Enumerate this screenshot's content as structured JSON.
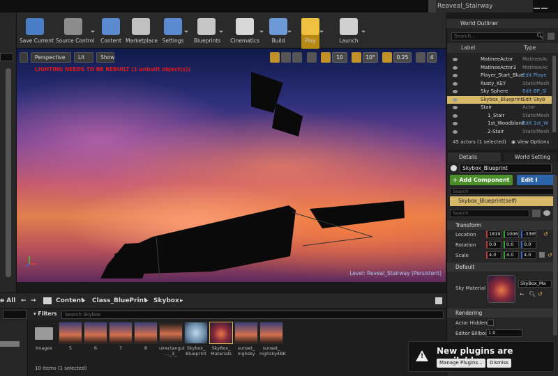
{
  "window": {
    "level_tab": "Reaveal_Stairway"
  },
  "toolbar": {
    "buttons": [
      {
        "label": "Save Current",
        "icon": "save-icon",
        "color": "#4a7fc8"
      },
      {
        "label": "Source Control",
        "icon": "source-control-icon",
        "color": "#8c8c8c"
      },
      {
        "label": "Content",
        "icon": "content-icon",
        "color": "#5a8ad0"
      },
      {
        "label": "Marketplace",
        "icon": "marketplace-icon",
        "color": "#c0c0c0"
      },
      {
        "label": "Settings",
        "icon": "settings-icon",
        "color": "#5a8ad0"
      },
      {
        "label": "Blueprints",
        "icon": "blueprints-icon",
        "color": "#c6c6c6"
      },
      {
        "label": "Cinematics",
        "icon": "cinematics-icon",
        "color": "#d8d8d8"
      },
      {
        "label": "Build",
        "icon": "build-icon",
        "color": "#6d9ad6"
      },
      {
        "label": "Play",
        "icon": "play-icon",
        "color": "#f0c040"
      },
      {
        "label": "Launch",
        "icon": "launch-icon",
        "color": "#d0d0d0"
      }
    ]
  },
  "viewport": {
    "perspective": "Perspective",
    "lit": "Lit",
    "show": "Show",
    "grid_snap": "10",
    "rot_snap": "10°",
    "scale_snap": "0.25",
    "cam_speed": "4",
    "warning": "LIGHTING NEEDS TO BE REBUILT (1 unbuilt object(s))",
    "level_label": "Level:  Reveal_Stairway (Persistent)"
  },
  "content_browser": {
    "add_all": "e All",
    "breadcrumb": [
      "Content",
      "Class_BluePrint",
      "Skybox"
    ],
    "filters": "Filters",
    "search_placeholder": "Search Skybox",
    "status": "10 items (1 selected)",
    "tiles": [
      {
        "label": "Images",
        "kind": "folder"
      },
      {
        "label": "5",
        "kind": "texture"
      },
      {
        "label": "6",
        "kind": "texture"
      },
      {
        "label": "7",
        "kind": "texture"
      },
      {
        "label": "8",
        "kind": "texture"
      },
      {
        "label": "uirectangul ..._3_",
        "kind": "texture"
      },
      {
        "label": "Skybox_ Blueprint",
        "kind": "blueprint"
      },
      {
        "label": "SkyBox_ Materials",
        "kind": "material",
        "selected": true
      },
      {
        "label": "sunset_ nighsky",
        "kind": "texture"
      },
      {
        "label": "sunset_ nighsky4BK",
        "kind": "texture"
      }
    ]
  },
  "outliner": {
    "tab": "World Outliner",
    "search_placeholder": "Search...",
    "col_label": "Label",
    "col_type": "Type",
    "rows": [
      {
        "label": "MatineeActor",
        "type": "MatineeAc",
        "link": false,
        "indent": 0
      },
      {
        "label": "MatineeActor3",
        "type": "MatineeAc",
        "link": false,
        "indent": 0
      },
      {
        "label": "Player_Start_Blue",
        "type": "Edit Playe",
        "link": true,
        "indent": 0
      },
      {
        "label": "Rusty_KEY",
        "type": "StaticMesh",
        "link": false,
        "indent": 0
      },
      {
        "label": "Sky Sphere",
        "type": "Edit BP_Sl",
        "link": true,
        "indent": 0
      },
      {
        "label": "Skybox_Blueprint",
        "type": "Edit Skyb",
        "link": true,
        "indent": 0,
        "selected": true
      },
      {
        "label": "Stair",
        "type": "Actor",
        "link": false,
        "indent": 0
      },
      {
        "label": "1_Stair",
        "type": "StaticMesh",
        "link": false,
        "indent": 1
      },
      {
        "label": "1st_Woodblank",
        "type": "Edit 1st_W",
        "link": true,
        "indent": 1
      },
      {
        "label": "2-Stair",
        "type": "StaticMesh",
        "link": false,
        "indent": 1
      }
    ],
    "count": "45 actors (1 selected)",
    "view_options": "View Options"
  },
  "details": {
    "tab": "Details",
    "tab2": "World Setting",
    "name": "Skybox_Blueprint",
    "add_component": "+ Add Component",
    "edit": "Edit I",
    "search1": "Search",
    "component": "Skybox_Blueprint(self)",
    "search2": "Search",
    "transform": "Transform",
    "location_label": "Location",
    "location": [
      "1819",
      "1006",
      "-3385"
    ],
    "rotation_label": "Rotation",
    "rotation": [
      "0.0",
      "0.0",
      "0.0"
    ],
    "scale_label": "Scale",
    "scale": [
      "4.0",
      "4.0",
      "4.0"
    ],
    "default": "Default",
    "sky_material_label": "Sky Material",
    "sky_material_value": "SkyBox_Ma",
    "rendering": "Rendering",
    "actor_hidden": "Actor Hidden",
    "editor_billboard_label": "Editor Billboa",
    "editor_billboard": "1.0"
  },
  "notification": {
    "text": "New plugins are available",
    "manage": "Manage Plugins...",
    "dismiss": "Dismiss"
  },
  "colors": {
    "accent": "#d8b96a",
    "add_component": "#4a8f2a",
    "edit_blueprint": "#2d63a8",
    "warning": "#e01818",
    "link": "#5e9fe6"
  }
}
